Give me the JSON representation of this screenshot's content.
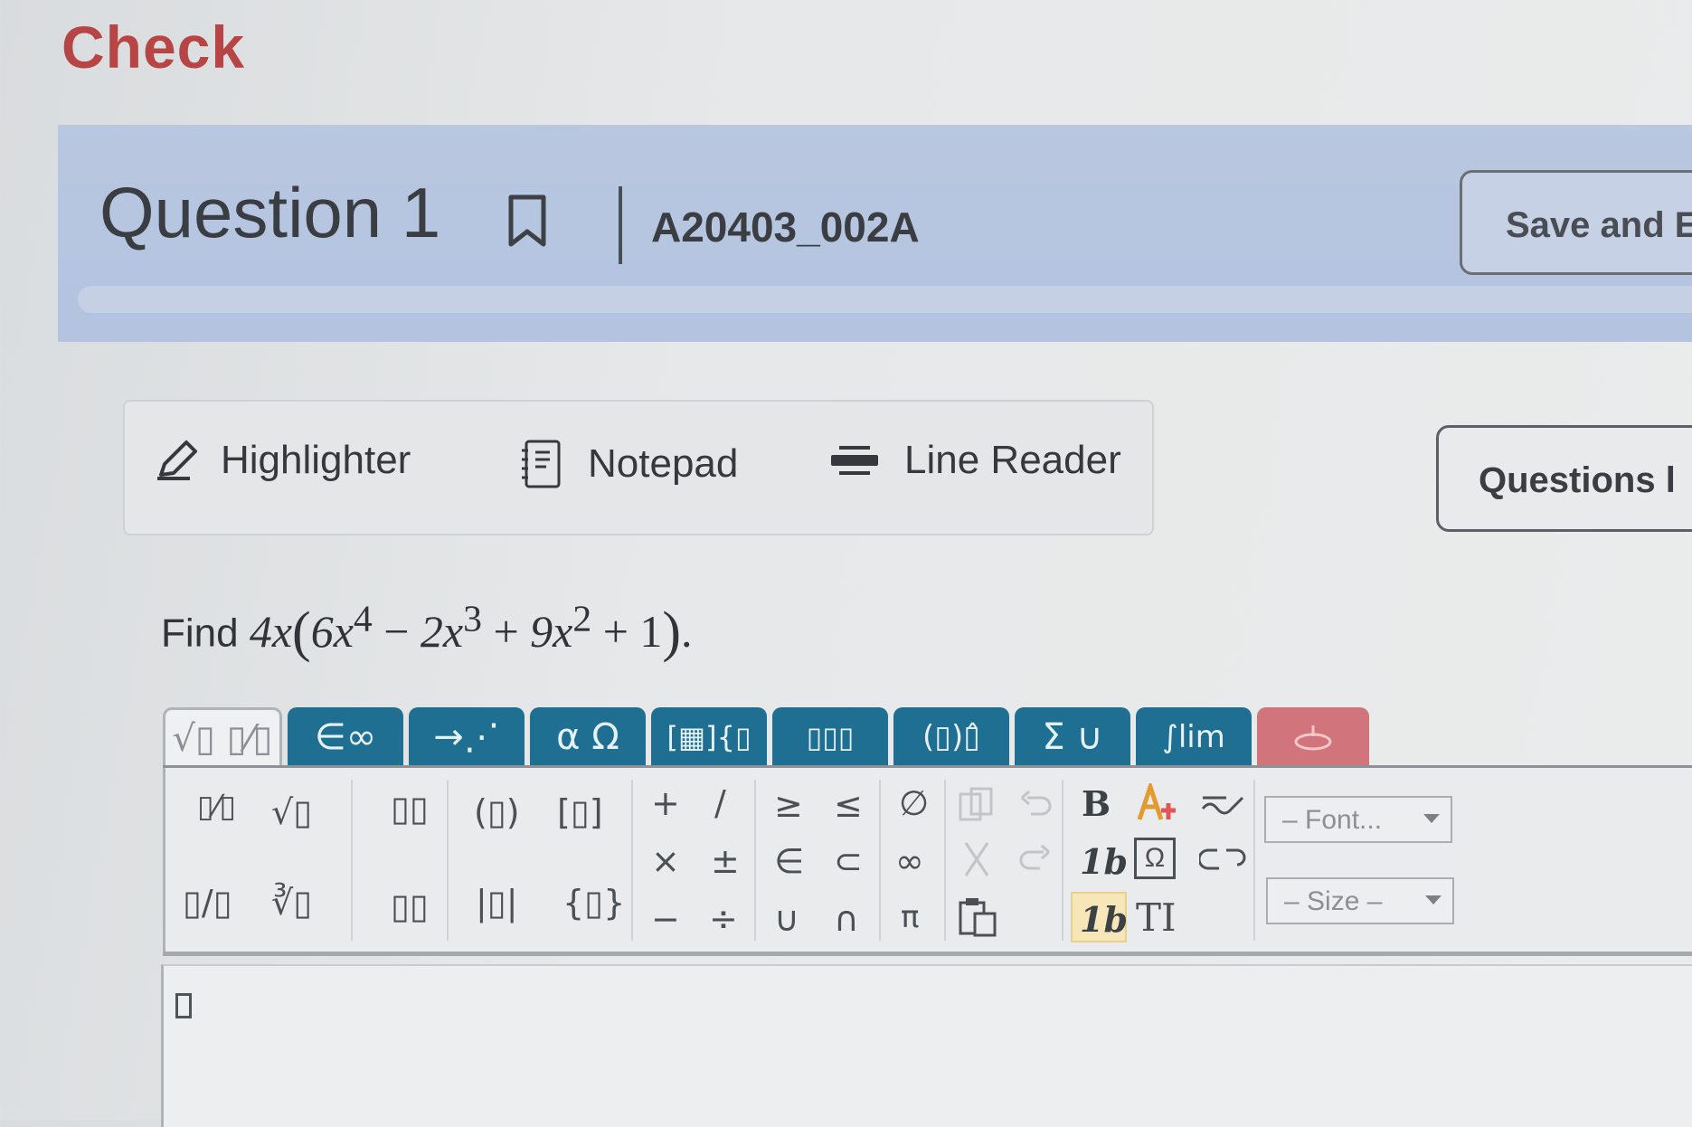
{
  "header": {
    "title": "Check"
  },
  "question_bar": {
    "title": "Question 1",
    "code": "A20403_002A",
    "save_label": "Save and E"
  },
  "tools": {
    "highlighter": "Highlighter",
    "notepad": "Notepad",
    "line_reader": "Line Reader"
  },
  "questions_nav": {
    "label": "Questions l"
  },
  "problem": {
    "prefix": "Find",
    "coef": "4x",
    "t1": "6x",
    "e1": "4",
    "op1": "−",
    "t2": "2x",
    "e2": "3",
    "op2": "+",
    "t3": "9x",
    "e3": "2",
    "op3": "+",
    "t4": "1",
    "end": "."
  },
  "editor": {
    "tabs": [
      "√▯ ▯⁄▯",
      "∈∞",
      "→⋰",
      "α Ω",
      "[▦]{▯",
      "▯▯▯",
      "(▯)▯̂",
      "Σ ∪",
      "∫lim",
      ""
    ],
    "palette": {
      "frac": "▯⁄▯",
      "sqrt": "√▯",
      "sup": "▯▯",
      "paren": "(▯)",
      "bracket": "[▯]",
      "slashfrac": "▯/▯",
      "nroot": "∛▯",
      "sub": "▯▯",
      "abs": "|▯|",
      "brace": "{▯}",
      "plus": "+",
      "slash": "/",
      "times": "×",
      "pm": "±",
      "minus": "−",
      "div": "÷",
      "ge": "≥",
      "le": "≤",
      "in": "∈",
      "subset": "⊂",
      "union": "∪",
      "intersect": "∩",
      "empty": "∅",
      "infinity": "∞",
      "pi": "π",
      "bold": "B",
      "italic1": "1b",
      "italic2": "1b",
      "omega": "Ω",
      "ti": "TI",
      "font": "– Font...",
      "size": "– Size –"
    }
  },
  "colors": {
    "check_red": "#b84545",
    "question_bar": "#b9c7e0",
    "tab_blue": "#1f6f93",
    "tab_red": "#d2747b"
  }
}
